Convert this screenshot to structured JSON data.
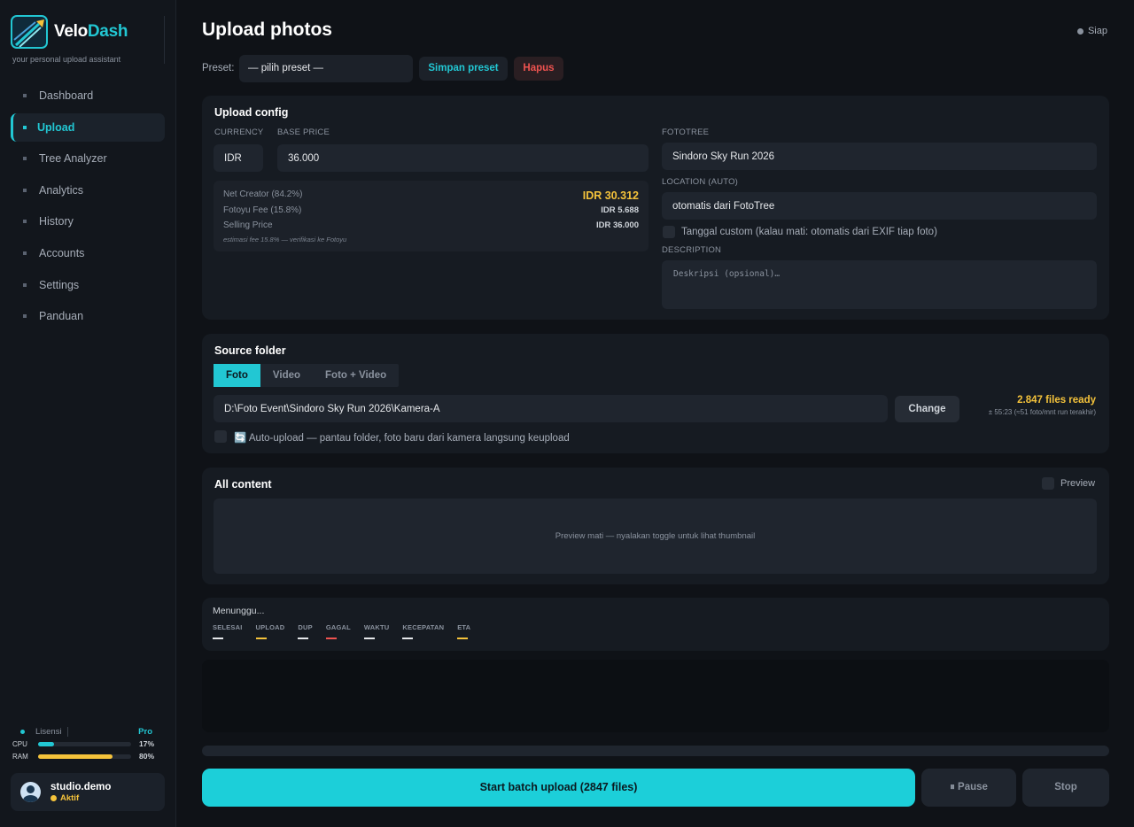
{
  "brand": {
    "name_a": "Velo",
    "name_b": "Dash",
    "tagline": "your personal upload assistant"
  },
  "sidebar": {
    "items": [
      {
        "label": "Dashboard"
      },
      {
        "label": "Upload",
        "active": true
      },
      {
        "label": "Tree Analyzer"
      },
      {
        "label": "Analytics"
      },
      {
        "label": "History"
      },
      {
        "label": "Accounts"
      },
      {
        "label": "Settings"
      },
      {
        "label": "Panduan"
      }
    ],
    "license": {
      "label": "Lisensi",
      "tier": "Pro"
    },
    "cpu": {
      "label": "CPU",
      "value": "17%",
      "fraction": 0.17
    },
    "ram": {
      "label": "RAM",
      "value": "80%",
      "fraction": 0.8
    },
    "user": {
      "name": "studio.demo",
      "status": "Aktif"
    }
  },
  "header": {
    "title": "Upload photos",
    "status": "Siap"
  },
  "preset": {
    "label": "Preset:",
    "select_value": "— pilih preset —",
    "save_label": "Simpan preset",
    "delete_label": "Hapus"
  },
  "upload_config": {
    "title": "Upload config",
    "currency_label": "CURRENCY",
    "currency": "IDR",
    "base_price_label": "BASE PRICE",
    "base_price": "36.000",
    "net_creator_label": "Net Creator (84.2%)",
    "net_creator": "IDR 30.312",
    "fee_label": "Fotoyu Fee (15.8%)",
    "fee": "IDR 5.688",
    "selling_label": "Selling Price",
    "selling": "IDR 36.000",
    "note": "estimasi fee 15.8% — verifikasi ke Fotoyu",
    "fototree_label": "FOTOTREE",
    "fototree": "Sindoro Sky Run 2026",
    "location_label": "LOCATION (AUTO)",
    "location": "otomatis dari FotoTree",
    "custom_date_label": "Tanggal custom (kalau mati: otomatis dari EXIF tiap foto)",
    "description_label": "DESCRIPTION",
    "description_placeholder": "Deskripsi (opsional)…"
  },
  "source": {
    "title": "Source folder",
    "tabs": [
      "Foto",
      "Video",
      "Foto + Video"
    ],
    "path": "D:\\Foto Event\\Sindoro Sky Run 2026\\Kamera-A",
    "change_label": "Change",
    "ready": "2.847 files ready",
    "eta_note": "± 55:23 (≈51 foto/mnt run terakhir)",
    "auto_upload_label": "🔄 Auto-upload — pantau folder, foto baru dari kamera langsung keupload"
  },
  "content": {
    "title": "All content",
    "preview_label": "Preview",
    "empty_text": "Preview mati — nyalakan toggle untuk lihat thumbnail"
  },
  "progress": {
    "status": "Menunggu...",
    "stats": [
      {
        "label": "SELESAI",
        "color": "#e6e8eb"
      },
      {
        "label": "UPLOAD",
        "color": "#f5c33b"
      },
      {
        "label": "DUP",
        "color": "#e6e8eb"
      },
      {
        "label": "GAGAL",
        "color": "#ef5350"
      },
      {
        "label": "WAKTU",
        "color": "#e6e8eb"
      },
      {
        "label": "KECEPATAN",
        "color": "#e6e8eb"
      },
      {
        "label": "ETA",
        "color": "#f5c33b"
      }
    ],
    "fraction": 0
  },
  "actions": {
    "start_label": "Start batch upload (2847 files)",
    "pause_label": "⏸ Pause",
    "stop_label": "Stop"
  },
  "colors": {
    "accent": "#22c7d3",
    "warning": "#f5c33b",
    "danger": "#ef5350"
  }
}
